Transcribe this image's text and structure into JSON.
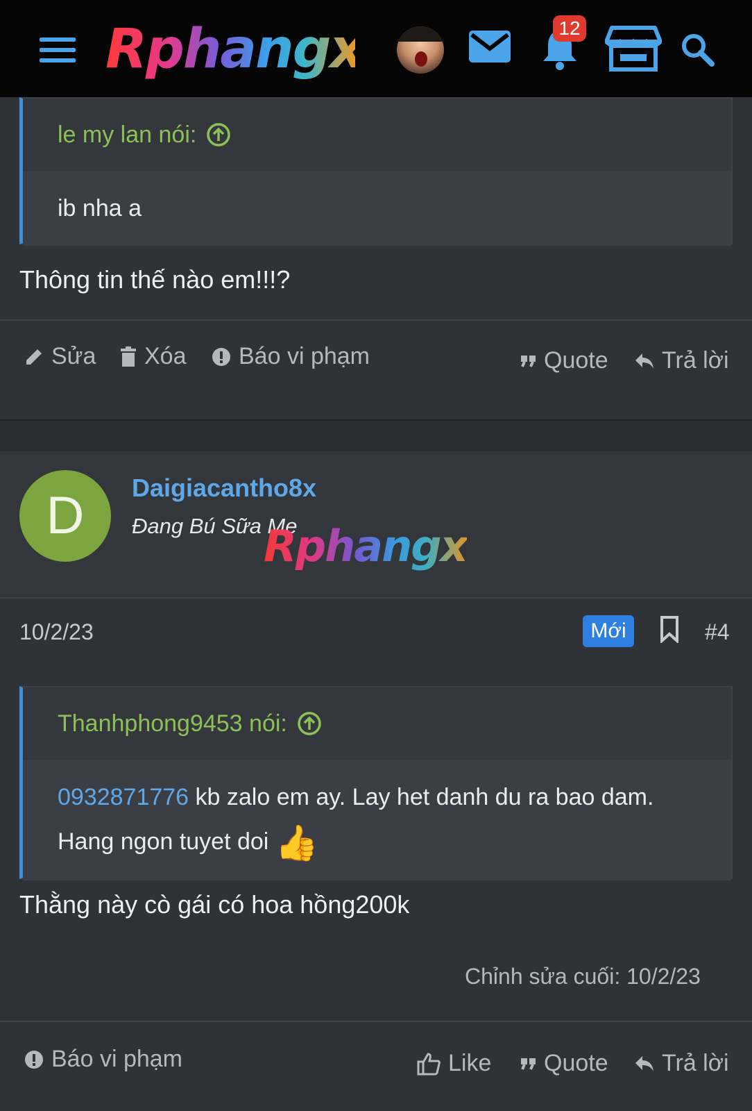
{
  "header": {
    "logo_text": "Rphangx",
    "notification_count": "12",
    "icons": [
      "menu-icon",
      "avatar",
      "mail-icon",
      "bell-icon",
      "store-icon",
      "search-icon"
    ],
    "accent_color": "#4ba3e8"
  },
  "post1": {
    "quote": {
      "author_label": "le my lan nói:",
      "text": "ib nha a"
    },
    "body": "Thông tin thế nào em!!!?",
    "actions": {
      "edit": "Sửa",
      "delete": "Xóa",
      "report": "Báo vi phạm",
      "quote": "Quote",
      "reply": "Trả lời"
    }
  },
  "post2": {
    "user": {
      "initial": "D",
      "name": "Daigiacantho8x",
      "title": "Đang Bú Sữa Me",
      "avatar_color": "#7ca53f"
    },
    "watermark": "Rphangx",
    "date": "10/2/23",
    "new_label": "Mới",
    "post_number": "#4",
    "quote": {
      "author_label": "Thanhphong9453 nói:",
      "phone": "0932871776",
      "text_after_phone": " kb zalo em ay. Lay het danh du ra bao dam.",
      "line2": "Hang ngon tuyet doi"
    },
    "body": "Thằng này cò gái có hoa hồng200k",
    "last_edited": "Chỉnh sửa cuối: 10/2/23",
    "actions": {
      "report": "Báo vi phạm",
      "like": "Like",
      "quote": "Quote",
      "reply": "Trả lời"
    }
  }
}
